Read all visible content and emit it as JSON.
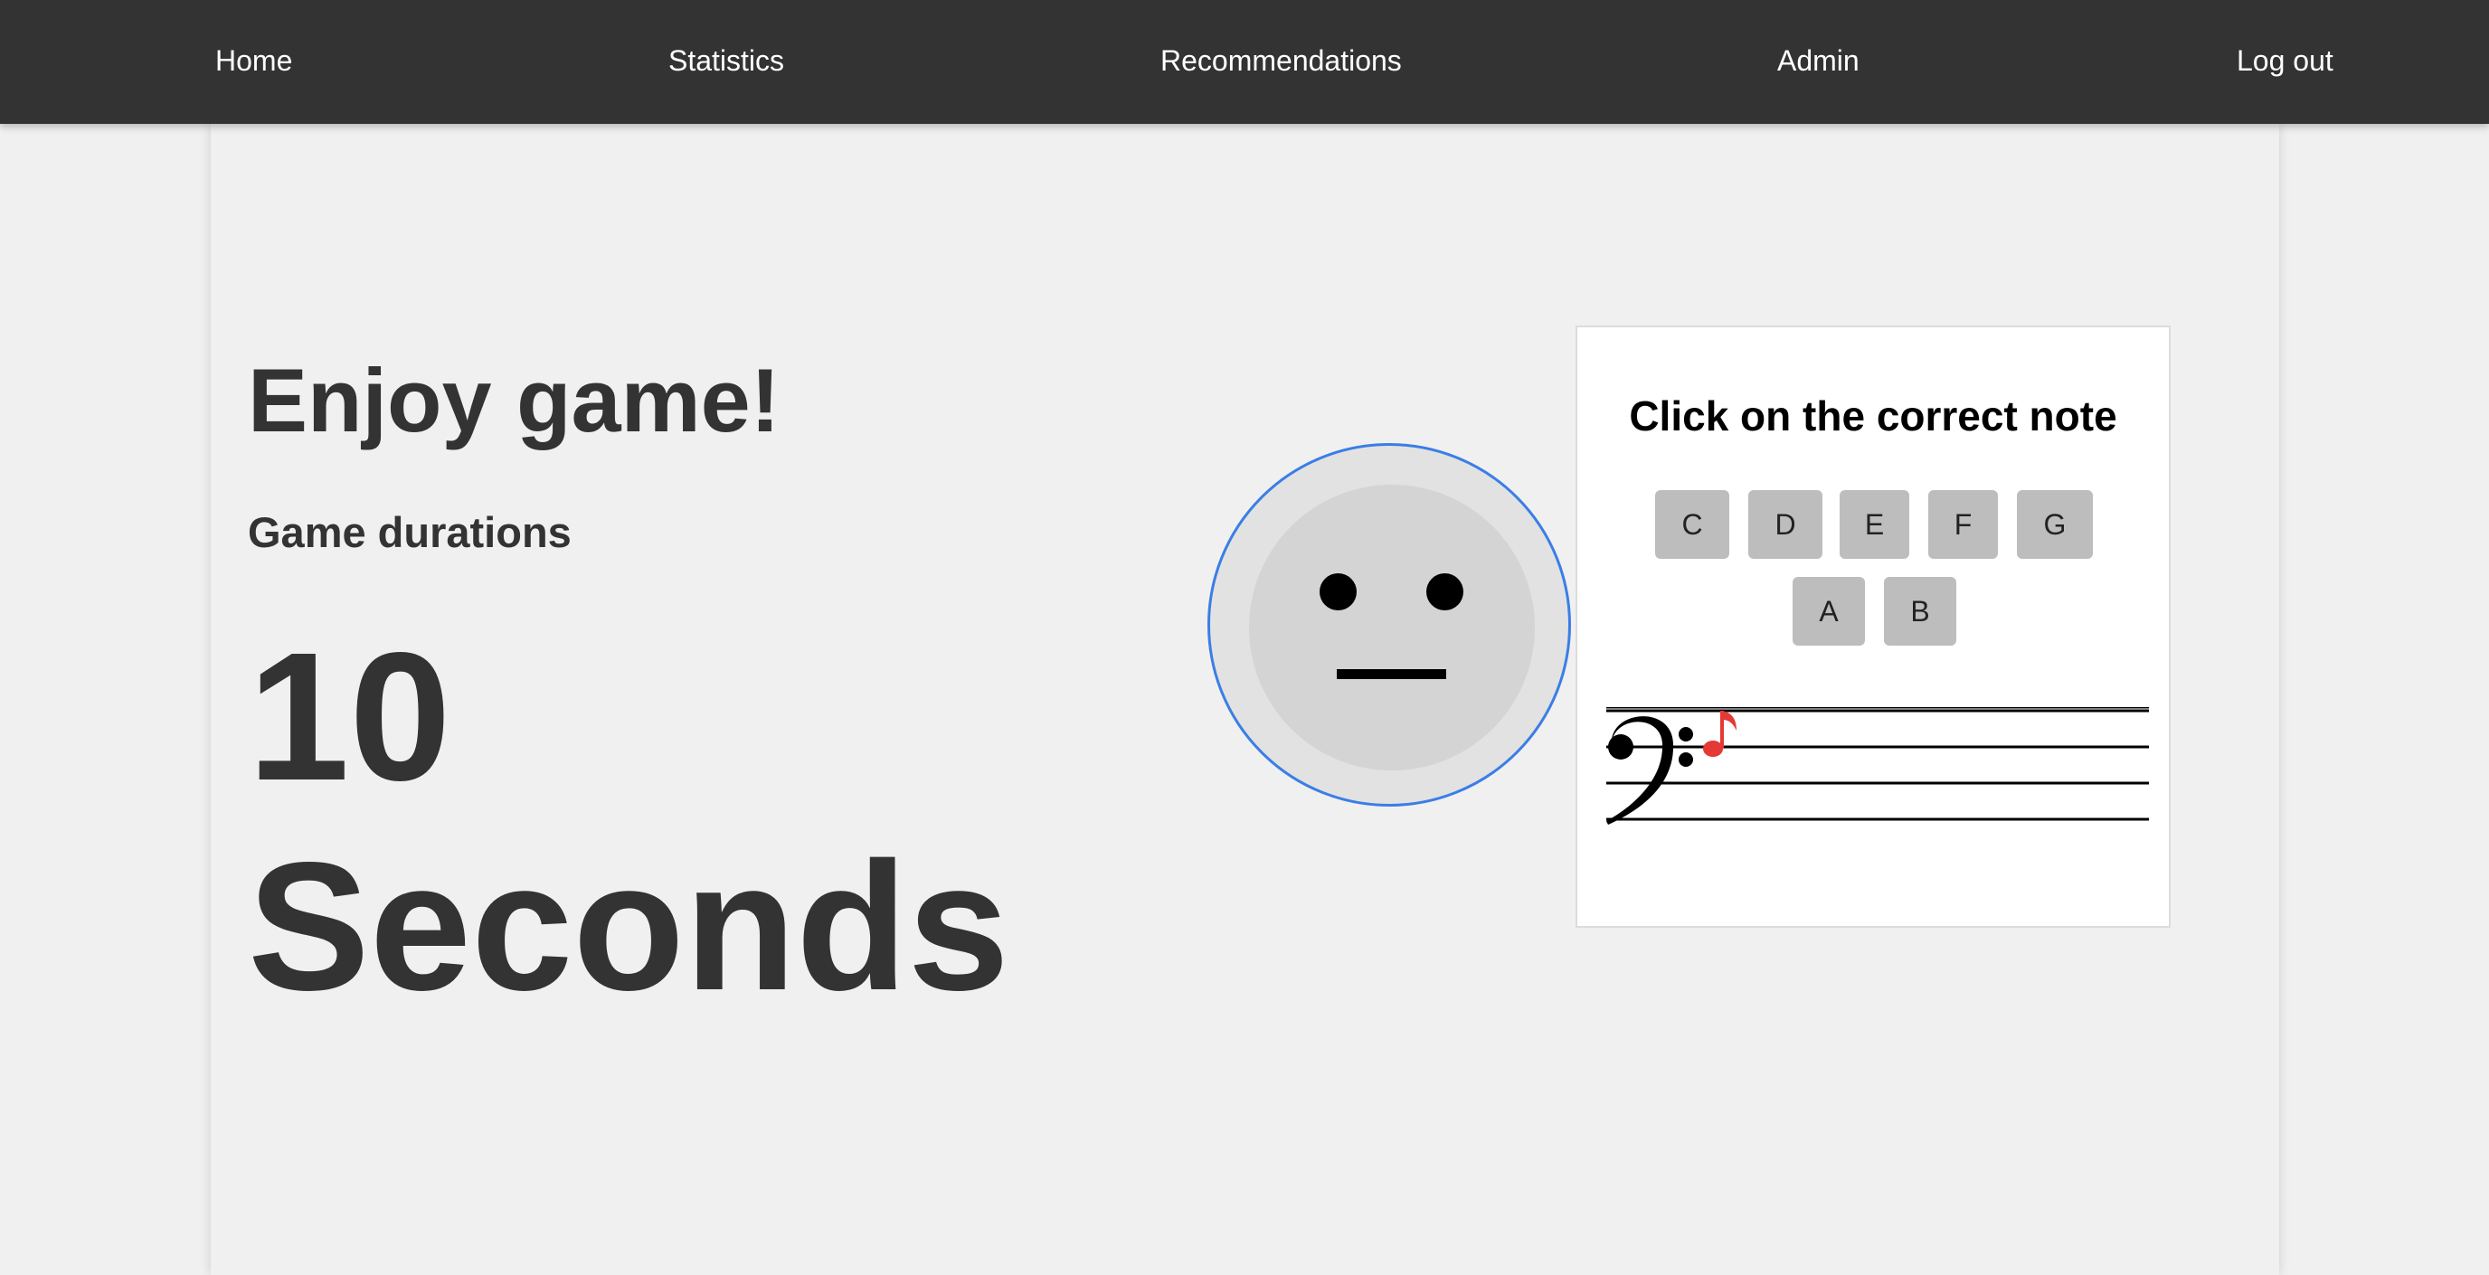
{
  "nav": {
    "home": "Home",
    "statistics": "Statistics",
    "recommendations": "Recommendations",
    "admin": "Admin",
    "logout": "Log out"
  },
  "main": {
    "heading": "Enjoy game!",
    "subheading": "Game durations",
    "duration_value": "10",
    "duration_unit": "Seconds"
  },
  "face": {
    "expression": "neutral-face",
    "ring_color": "#3a7ee6"
  },
  "game": {
    "instruction": "Click on the correct note",
    "notes": [
      "C",
      "D",
      "E",
      "F",
      "G",
      "A",
      "B"
    ],
    "clef": "bass-clef",
    "note_color": "#e53935"
  },
  "colors": {
    "nav_background": "#333333",
    "page_background": "#f0f0f0",
    "button_background": "#bdbdbd"
  }
}
